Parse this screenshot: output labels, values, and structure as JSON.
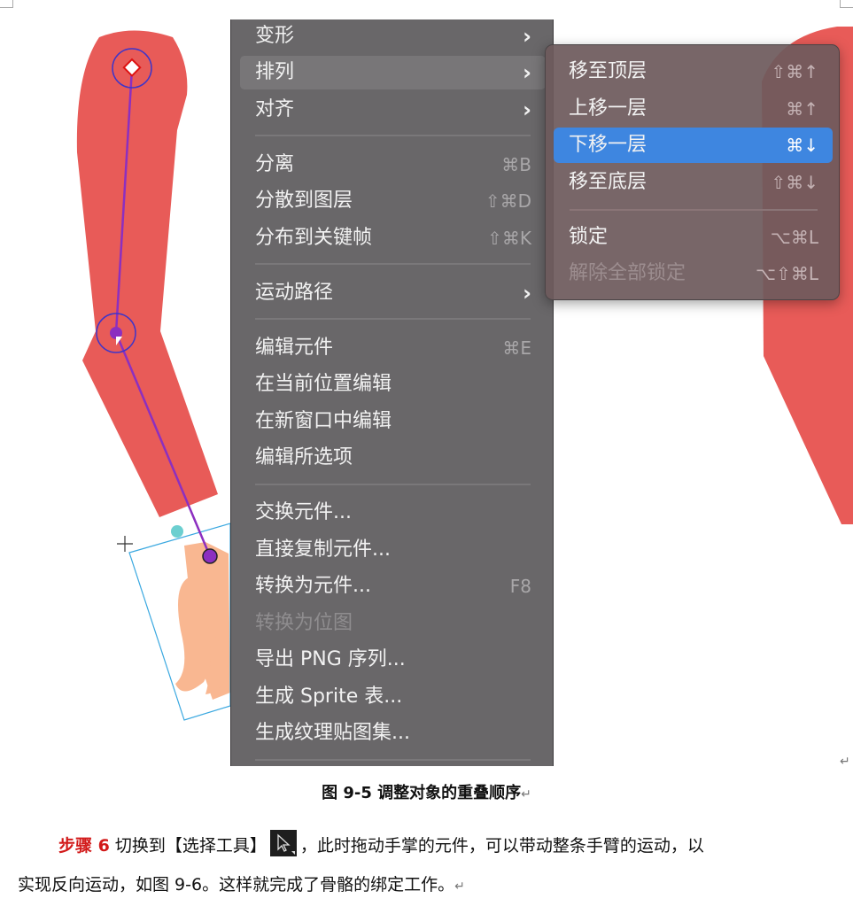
{
  "menu": {
    "items": [
      {
        "label": "变形",
        "shortcut": "",
        "arrow": "›"
      },
      {
        "label": "排列",
        "shortcut": "",
        "arrow": "›"
      },
      {
        "label": "对齐",
        "shortcut": "",
        "arrow": "›"
      },
      {
        "label": "分离",
        "shortcut": "⌘B",
        "arrow": ""
      },
      {
        "label": "分散到图层",
        "shortcut": "⇧⌘D",
        "arrow": ""
      },
      {
        "label": "分布到关键帧",
        "shortcut": "⇧⌘K",
        "arrow": ""
      },
      {
        "label": "运动路径",
        "shortcut": "",
        "arrow": "›"
      },
      {
        "label": "编辑元件",
        "shortcut": "⌘E",
        "arrow": ""
      },
      {
        "label": "在当前位置编辑",
        "shortcut": "",
        "arrow": ""
      },
      {
        "label": "在新窗口中编辑",
        "shortcut": "",
        "arrow": ""
      },
      {
        "label": "编辑所选项",
        "shortcut": "",
        "arrow": ""
      },
      {
        "label": "交换元件...",
        "shortcut": "",
        "arrow": ""
      },
      {
        "label": "直接复制元件...",
        "shortcut": "",
        "arrow": ""
      },
      {
        "label": "转换为元件...",
        "shortcut": "F8",
        "arrow": ""
      },
      {
        "label": "转换为位图",
        "shortcut": "",
        "arrow": ""
      },
      {
        "label": "导出 PNG 序列...",
        "shortcut": "",
        "arrow": ""
      },
      {
        "label": "生成 Sprite 表...",
        "shortcut": "",
        "arrow": ""
      },
      {
        "label": "生成纹理贴图集...",
        "shortcut": "",
        "arrow": ""
      }
    ]
  },
  "submenu": {
    "items": [
      {
        "label": "移至顶层",
        "shortcut": "⇧⌘↑"
      },
      {
        "label": "上移一层",
        "shortcut": "⌘↑"
      },
      {
        "label": "下移一层",
        "shortcut": "⌘↓"
      },
      {
        "label": "移至底层",
        "shortcut": "⇧⌘↓"
      },
      {
        "label": "锁定",
        "shortcut": "⌥⌘L"
      },
      {
        "label": "解除全部锁定",
        "shortcut": "⌥⇧⌘L"
      }
    ]
  },
  "caption": {
    "text": "图 9-5 调整对象的重叠顺序",
    "mark": "↵"
  },
  "paragraph": {
    "step_label": "步骤 6",
    "part1": " 切换到【选择工具】",
    "part2": "，此时拖动手掌的元件，可以带动整条手臂的运动，以",
    "line2": "实现反向运动，如图 9-6。这样就完成了骨骼的绑定工作。",
    "mark": "↵"
  },
  "colors": {
    "arm": "#e85b58",
    "hand": "#f9b791",
    "bone": "#8c2fc0",
    "selection": "#3aa8e0",
    "menu_bg": "#5c5a5c",
    "submenu_selected": "#3e86e0",
    "step_red": "#d21a1a"
  },
  "icons": {
    "submenu_arrow": "chevron-right-icon",
    "select_tool": "arrow-cursor-icon"
  }
}
